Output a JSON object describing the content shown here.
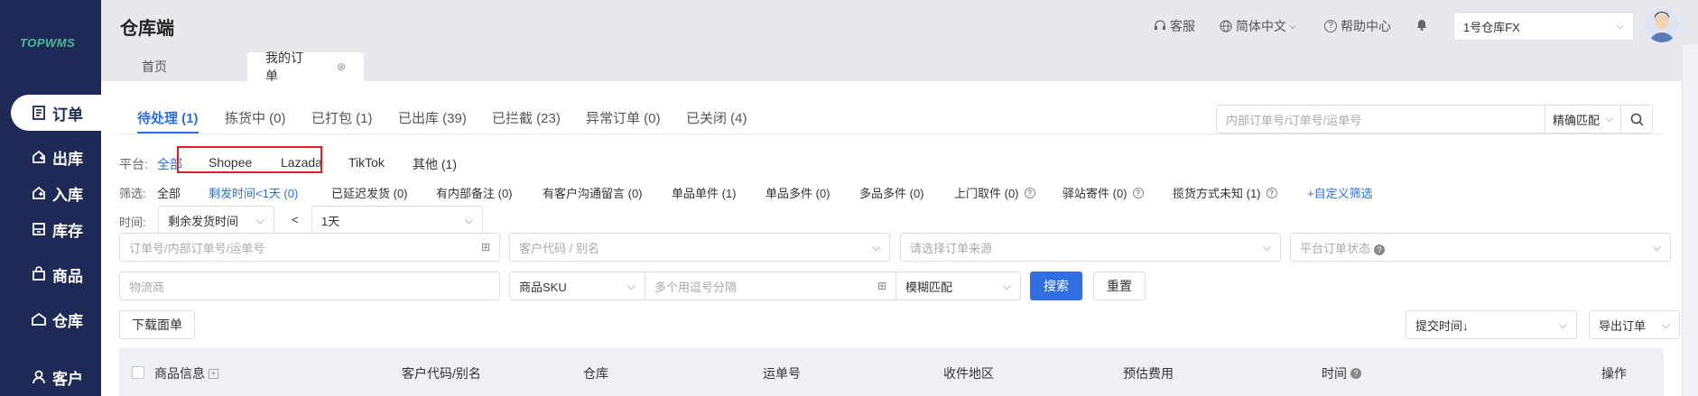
{
  "brand": {
    "logo_text": "TOPWMS"
  },
  "sidebar": {
    "items": [
      {
        "label": "订单",
        "icon": "order-icon"
      },
      {
        "label": "出库",
        "icon": "outbound-icon"
      },
      {
        "label": "入库",
        "icon": "inbound-icon"
      },
      {
        "label": "库存",
        "icon": "inventory-icon"
      },
      {
        "label": "商品",
        "icon": "goods-icon"
      },
      {
        "label": "仓库",
        "icon": "warehouse-icon"
      },
      {
        "label": "客户",
        "icon": "customer-icon"
      }
    ]
  },
  "header": {
    "title": "仓库端",
    "service": "客服",
    "language": "简体中文",
    "help": "帮助中心",
    "warehouse": "1号仓库FX"
  },
  "page_tabs": {
    "home": "首页",
    "orders": "我的订单",
    "close": "⊗"
  },
  "status_tabs": [
    "待处理 (1)",
    "拣货中 (0)",
    "已打包 (1)",
    "已出库 (39)",
    "已拦截 (23)",
    "异常订单 (0)",
    "已关闭 (4)"
  ],
  "search": {
    "placeholder": "内部订单号/订单号/运单号",
    "match": "精确匹配"
  },
  "platform": {
    "label": "平台:",
    "options": [
      "全部",
      "Shopee",
      "Lazada",
      "TikTok",
      "其他 (1)"
    ]
  },
  "filter": {
    "label": "筛选:",
    "all": "全部",
    "options": [
      "剩发时间<1天 (0)",
      "已延迟发货 (0)",
      "有内部备注 (0)",
      "有客户沟通留言 (0)",
      "单品单件 (1)",
      "单品多件 (0)",
      "多品多件 (0)",
      "上门取件 (0)",
      "驿站寄件 (0)",
      "揽货方式未知 (1)"
    ],
    "custom": "+自定义筛选"
  },
  "time": {
    "label": "时间:",
    "field": "剩余发货时间",
    "op": "<",
    "value": "1天"
  },
  "fields": {
    "order_no": "订单号/内部订单号/运单号",
    "customer": "客户代码 / 别名",
    "source": "请选择订单来源",
    "platform_status": "平台订单状态",
    "logistics": "物流商",
    "sku_type": "商品SKU",
    "sku_input": "多个用逗号分隔",
    "fuzzy": "模糊匹配",
    "search_btn": "搜索",
    "reset_btn": "重置"
  },
  "actions": {
    "download": "下载面单",
    "sort": "提交时间↓",
    "export": "导出订单"
  },
  "table": {
    "columns": [
      "商品信息",
      "客户代码/别名",
      "仓库",
      "运单号",
      "收件地区",
      "预估费用",
      "时间",
      "操作"
    ]
  },
  "colors": {
    "sidebar": "#1c2a55",
    "accent": "#2f6fe0",
    "highlight": "#e02020"
  }
}
